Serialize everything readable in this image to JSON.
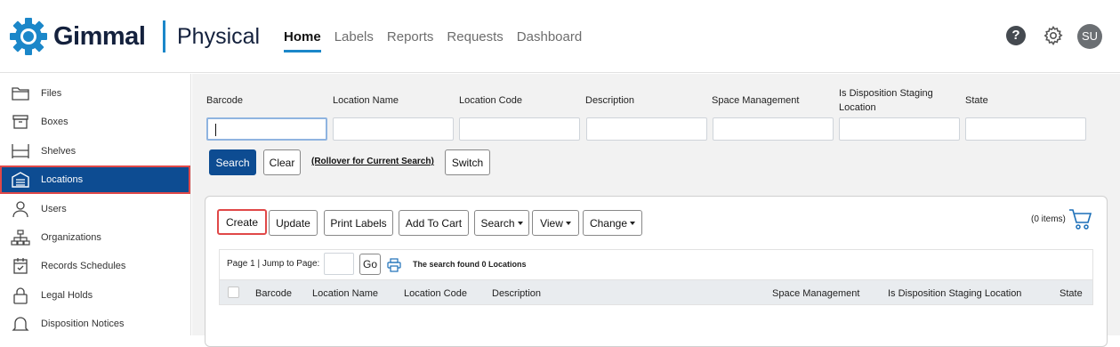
{
  "header": {
    "brand": "Gimmal",
    "product": "Physical",
    "nav": [
      "Home",
      "Labels",
      "Reports",
      "Requests",
      "Dashboard"
    ],
    "active_nav": "Home",
    "help": "?",
    "avatar": "SU",
    "accent_color": "#1b87c9",
    "brand_color": "#14213d"
  },
  "sidebar": {
    "items": [
      {
        "label": "Files",
        "icon": "folder-icon"
      },
      {
        "label": "Boxes",
        "icon": "box-icon"
      },
      {
        "label": "Shelves",
        "icon": "shelf-icon"
      },
      {
        "label": "Locations",
        "icon": "warehouse-icon"
      },
      {
        "label": "Users",
        "icon": "user-icon"
      },
      {
        "label": "Organizations",
        "icon": "org-chart-icon"
      },
      {
        "label": "Records Schedules",
        "icon": "calendar-icon"
      },
      {
        "label": "Legal Holds",
        "icon": "lock-icon"
      },
      {
        "label": "Disposition Notices",
        "icon": "bell-icon"
      }
    ],
    "active": "Locations",
    "active_color": "#0d4c92"
  },
  "search": {
    "fields": [
      {
        "label": "Barcode",
        "value": ""
      },
      {
        "label": "Location Name",
        "value": ""
      },
      {
        "label": "Location Code",
        "value": ""
      },
      {
        "label": "Description",
        "value": ""
      },
      {
        "label": "Space Management",
        "value": ""
      },
      {
        "label": "Is Disposition Staging Location",
        "value": ""
      },
      {
        "label": "State",
        "value": ""
      }
    ],
    "search_label": "Search",
    "clear_label": "Clear",
    "rollover_label": "(Rollover for Current Search)",
    "switch_label": "Switch"
  },
  "toolbar": {
    "create": "Create",
    "update": "Update",
    "print_labels": "Print Labels",
    "add_to_cart": "Add To Cart",
    "search": "Search",
    "view": "View",
    "change": "Change",
    "cart_count": "(0 items)"
  },
  "pager": {
    "page_text": "Page 1 | Jump to Page:",
    "go_label": "Go",
    "found_text": "The search found 0 Locations"
  },
  "table": {
    "columns": [
      "Barcode",
      "Location Name",
      "Location Code",
      "Description",
      "Space Management",
      "Is Disposition Staging Location",
      "State"
    ]
  }
}
